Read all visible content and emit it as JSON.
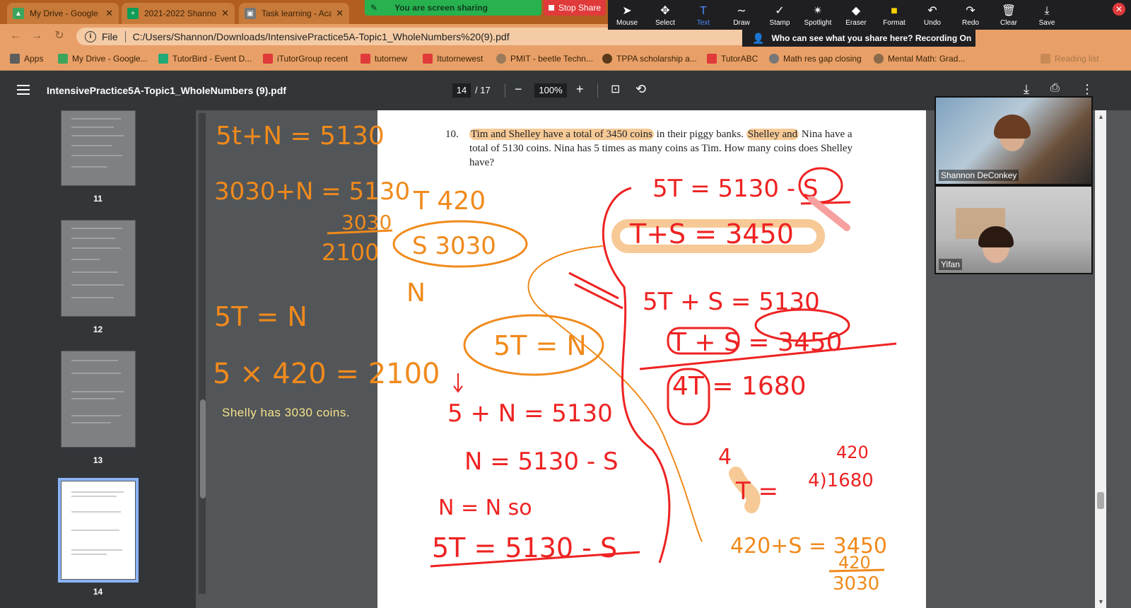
{
  "browser": {
    "tabs": [
      {
        "label": "My Drive - Google",
        "color": "#3ba55c"
      },
      {
        "label": "2021-2022 Shanno",
        "color": "#0f9d58"
      },
      {
        "label": "Task learning - Aca",
        "color": "#777777"
      }
    ],
    "address": {
      "prefix": "File",
      "url": "C:/Users/Shannon/Downloads/IntensivePractice5A-Topic1_WholeNumbers%20(9).pdf"
    },
    "bookmarks": [
      {
        "label": "Apps"
      },
      {
        "label": "My Drive - Google..."
      },
      {
        "label": "TutorBird - Event D..."
      },
      {
        "label": "iTutorGroup recent"
      },
      {
        "label": "tutornew"
      },
      {
        "label": "Itutornewest"
      },
      {
        "label": "PMIT - beetle Techn..."
      },
      {
        "label": "TPPA scholarship a..."
      },
      {
        "label": "TutorABC"
      },
      {
        "label": "Math res gap closing"
      },
      {
        "label": "Mental Math: Grad..."
      },
      {
        "label": "Reading list"
      }
    ]
  },
  "zoom": {
    "share_banner": "You are screen sharing",
    "stop_share": "Stop Share",
    "who_can_see": "Who can see what you share here? Recording On",
    "tools": [
      {
        "label": "Mouse",
        "glyph": "➤"
      },
      {
        "label": "Select",
        "glyph": "✥"
      },
      {
        "label": "Text",
        "glyph": "T"
      },
      {
        "label": "Draw",
        "glyph": "∼"
      },
      {
        "label": "Stamp",
        "glyph": "✓"
      },
      {
        "label": "Spotlight",
        "glyph": "✴"
      },
      {
        "label": "Eraser",
        "glyph": "◆"
      },
      {
        "label": "Format",
        "glyph": "■"
      },
      {
        "label": "Undo",
        "glyph": "↶"
      },
      {
        "label": "Redo",
        "glyph": "↷"
      },
      {
        "label": "Clear",
        "glyph": "🗑"
      },
      {
        "label": "Save",
        "glyph": "⤓"
      }
    ],
    "participants": [
      {
        "name": "Shannon DeConkey"
      },
      {
        "name": "Yifan"
      }
    ]
  },
  "pdf": {
    "title": "IntensivePractice5A-Topic1_WholeNumbers (9).pdf",
    "page_current": "14",
    "page_total": "/ 17",
    "zoom_level": "100%",
    "thumbnails": [
      {
        "number": "11"
      },
      {
        "number": "12"
      },
      {
        "number": "13"
      },
      {
        "number": "14"
      }
    ],
    "problem": {
      "number": "10.",
      "highlight_1": "Tim and Shelley have a total of 3450 coins",
      "text_1": " in their piggy banks. ",
      "highlight_2": "Shelley and",
      "text_2": " Nina have a total of 5130 coins. Nina has 5 times as many coins as Tim. How many coins does Shelley have?"
    },
    "caption": "Shelly has 3030 coins."
  },
  "annotations": {
    "orange": [
      "5t+N = 5130",
      "3030+N = 5130",
      "3030",
      "2100",
      "T 420",
      "S 3030",
      "N",
      "5T = N",
      "5 × 420 = 2100",
      "5T = N",
      "420+S = 3450",
      "420",
      "3030"
    ],
    "red": [
      "5T = 5130 - S",
      "T+S = 3450",
      "5T + S = 5130",
      "T + S = 3450",
      "4T = 1680",
      "4",
      "T =",
      "420",
      "4)1680",
      "5 + N = 5130",
      "N = 5130 - S",
      "N = N so",
      "5T = 5130 - S"
    ],
    "colors": {
      "orange": "#f08a1c",
      "red": "#ee2222",
      "highlight": "#f6c996",
      "caption": "#f6e08a"
    }
  }
}
